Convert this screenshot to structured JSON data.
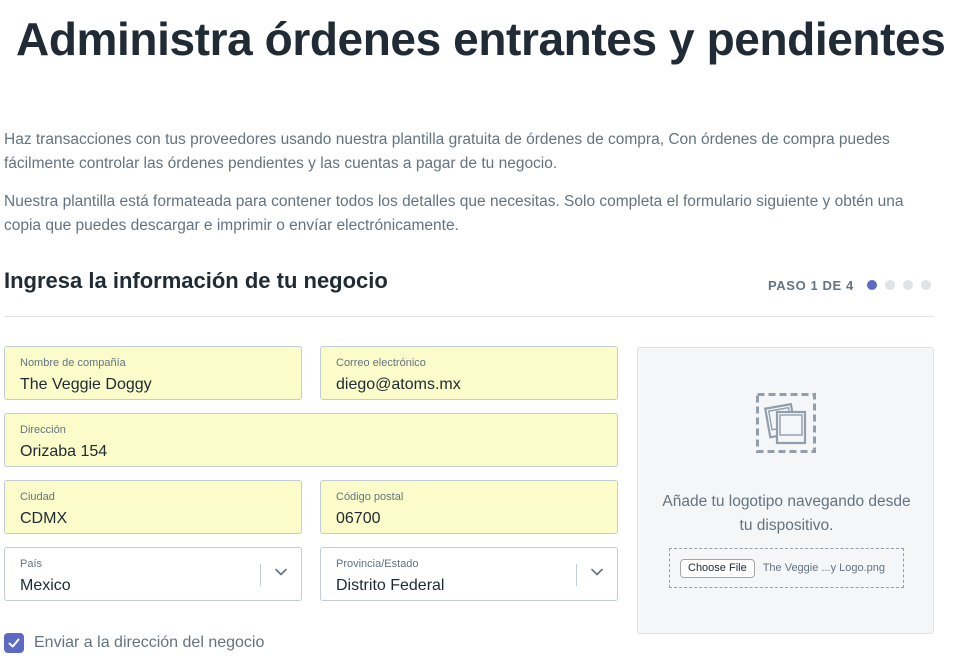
{
  "page_title": "Administra órdenes entrantes y pendientes",
  "intro": [
    "Haz transacciones con tus proveedores usando nuestra plantilla gratuita de órdenes de compra, Con órdenes de compra puedes fácilmente controlar las órdenes pendientes y las cuentas a pagar de tu negocio.",
    "Nuestra plantilla está formateada para contener todos los detalles que necesitas. Solo completa el formulario siguiente y obtén una copia que puedes descargar e imprimir o envíar electrónicamente."
  ],
  "section": {
    "title": "Ingresa la información de tu negocio",
    "step": "PASO 1 DE 4",
    "step_current": 1,
    "step_total": 4
  },
  "form": {
    "company": {
      "label": "Nombre de compañía",
      "value": "The Veggie Doggy"
    },
    "email": {
      "label": "Correo electrónico",
      "value": "diego@atoms.mx"
    },
    "address": {
      "label": "Dirección",
      "value": "Orizaba 154"
    },
    "city": {
      "label": "Ciudad",
      "value": "CDMX"
    },
    "postal": {
      "label": "Código postal",
      "value": "06700"
    },
    "country": {
      "label": "País",
      "value": "Mexico"
    },
    "state": {
      "label": "Provincia/Estado",
      "value": "Distrito Federal"
    }
  },
  "upload": {
    "text": "Añade tu logotipo navegando desde tu dispositivo.",
    "button_label": "Choose File",
    "file_name": "The Veggie ...y Logo.png"
  },
  "shipping_checkbox": {
    "label": "Enviar a la dirección del negocio",
    "checked": true
  },
  "colors": {
    "field_fill": "#fbfcc9",
    "accent": "#5c6ac4",
    "muted_text": "#637381",
    "heading_text": "#212b36"
  }
}
